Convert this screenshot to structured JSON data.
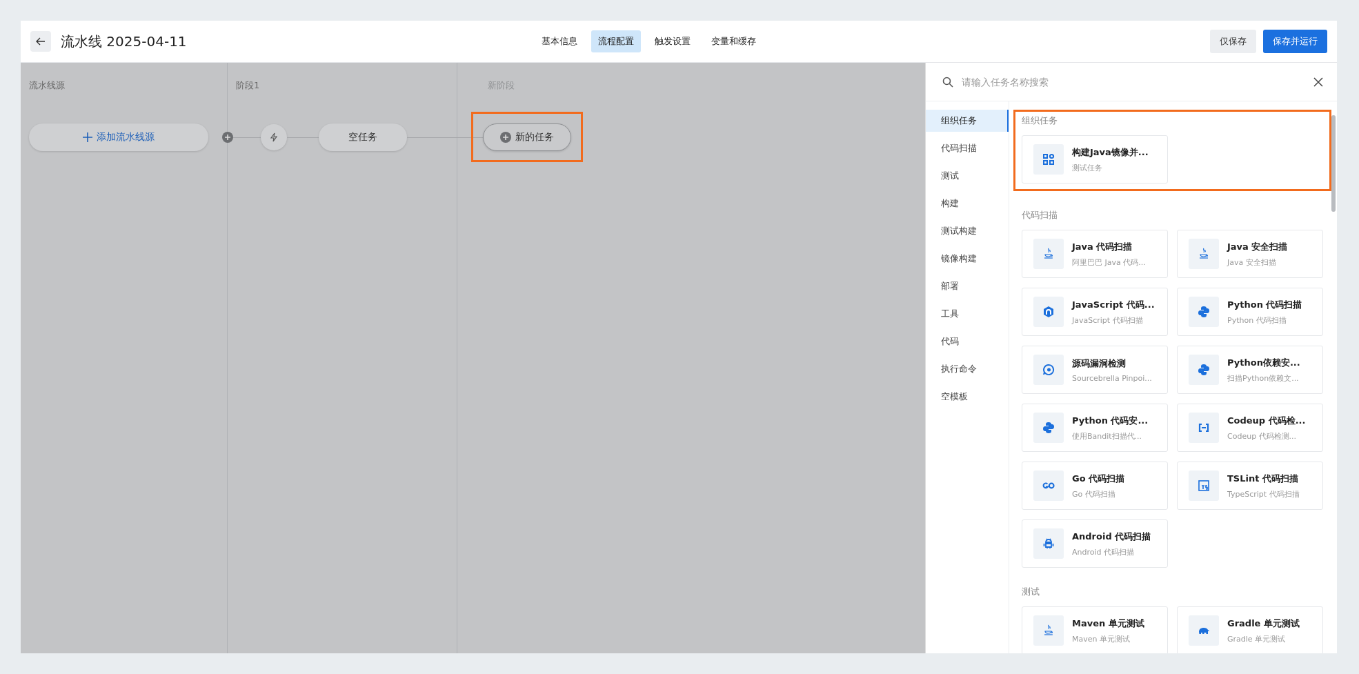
{
  "header": {
    "title": "流水线 2025-04-11",
    "tabs": [
      {
        "label": "基本信息",
        "selected": false
      },
      {
        "label": "流程配置",
        "selected": true
      },
      {
        "label": "触发设置",
        "selected": false
      },
      {
        "label": "变量和缓存",
        "selected": false
      }
    ],
    "buttons": [
      {
        "label": "仅保存",
        "kind": "secondary"
      },
      {
        "label": "保存并运行",
        "kind": "primary"
      }
    ]
  },
  "canvas": {
    "columns": [
      {
        "title": "流水线源",
        "kind": "stage"
      },
      {
        "title": "阶段1",
        "kind": "stage"
      },
      {
        "title": "新阶段",
        "kind": "placeholder"
      }
    ],
    "add_source": {
      "label": "添加流水线源"
    },
    "empty_task": {
      "label": "空任务"
    },
    "new_task": {
      "label": "新的任务",
      "highlighted": true
    }
  },
  "panel": {
    "search": {
      "placeholder": "请输入任务名称搜索"
    },
    "categories": [
      {
        "label": "组织任务",
        "selected": true
      },
      {
        "label": "代码扫描",
        "selected": false
      },
      {
        "label": "测试",
        "selected": false
      },
      {
        "label": "构建",
        "selected": false
      },
      {
        "label": "测试构建",
        "selected": false
      },
      {
        "label": "镜像构建",
        "selected": false
      },
      {
        "label": "部署",
        "selected": false
      },
      {
        "label": "工具",
        "selected": false
      },
      {
        "label": "代码",
        "selected": false
      },
      {
        "label": "执行命令",
        "selected": false
      },
      {
        "label": "空模板",
        "selected": false
      }
    ],
    "sections": [
      {
        "title": "组织任务",
        "highlighted": true,
        "tasks": [
          {
            "name": "构建Java镜像并...",
            "description": "测试任务",
            "kind": "grid"
          }
        ]
      },
      {
        "title": "代码扫描",
        "highlighted": false,
        "tasks": [
          {
            "name": "Java 代码扫描",
            "description": "阿里巴巴 Java 代码...",
            "kind": "cup"
          },
          {
            "name": "Java 安全扫描",
            "description": "Java 安全扫描",
            "kind": "cup"
          },
          {
            "name": "JavaScript 代码...",
            "description": "JavaScript 代码扫描",
            "kind": "hexagon"
          },
          {
            "name": "Python 代码扫描",
            "description": "Python 代码扫描",
            "kind": "snakes"
          },
          {
            "name": "源码漏洞检测",
            "description": "Sourcebrella Pinpoi...",
            "kind": "bubble"
          },
          {
            "name": "Python依赖安...",
            "description": "扫描Python依赖文...",
            "kind": "snakes"
          },
          {
            "name": "Python 代码安...",
            "description": "使用Bandit扫描代...",
            "kind": "snakes"
          },
          {
            "name": "Codeup 代码检...",
            "description": "Codeup 代码检测...",
            "kind": "bracket"
          },
          {
            "name": "Go 代码扫描",
            "description": "Go 代码扫描",
            "kind": "rings"
          },
          {
            "name": "TSLint 代码扫描",
            "description": "TypeScript 代码扫描",
            "kind": "square"
          },
          {
            "name": "Android 代码扫描",
            "description": "Android 代码扫描",
            "kind": "robot"
          }
        ]
      },
      {
        "title": "测试",
        "highlighted": false,
        "tasks": [
          {
            "name": "Maven 单元测试",
            "description": "Maven 单元测试",
            "kind": "cup"
          },
          {
            "name": "Gradle 单元测试",
            "description": "Gradle 单元测试",
            "kind": "elephant"
          }
        ]
      }
    ]
  }
}
